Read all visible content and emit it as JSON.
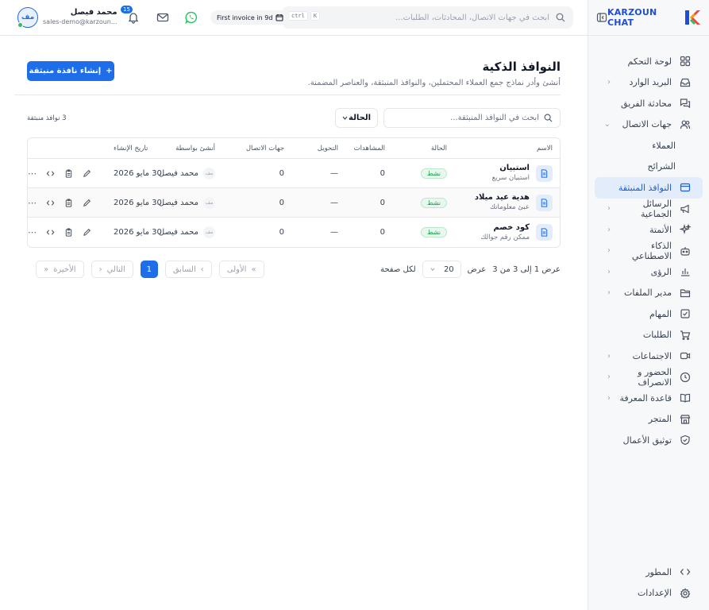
{
  "brand": {
    "name": "KARZOUN CHAT"
  },
  "sidebar": {
    "items": [
      {
        "label": "لوحة التحكم",
        "icon": "dashboard-icon",
        "has_children": false
      },
      {
        "label": "البريد الوارد",
        "icon": "inbox-icon",
        "has_children": true
      },
      {
        "label": "محادثة الفريق",
        "icon": "team-chat-icon",
        "has_children": false
      },
      {
        "label": "جهات الاتصال",
        "icon": "contacts-icon",
        "has_children": true,
        "expanded": true
      },
      {
        "label": "العملاء",
        "sub": true
      },
      {
        "label": "الشرائح",
        "sub": true
      },
      {
        "label": "النوافذ المنبثقة",
        "icon": "popup-icon",
        "active": true
      },
      {
        "label": "الرسائل الجماعية",
        "icon": "megaphone-icon",
        "has_children": true
      },
      {
        "label": "الأتمتة",
        "icon": "sparkles-icon",
        "has_children": true
      },
      {
        "label": "الذكاء الاصطناعي",
        "icon": "robot-icon",
        "has_children": true
      },
      {
        "label": "الرؤى",
        "icon": "chart-icon",
        "has_children": true
      },
      {
        "label": "مدير الملفات",
        "icon": "folder-icon",
        "has_children": true
      },
      {
        "label": "المهام",
        "icon": "task-icon",
        "has_children": false
      },
      {
        "label": "الطلبات",
        "icon": "cart-icon",
        "has_children": false
      },
      {
        "label": "الاجتماعات",
        "icon": "video-icon",
        "has_children": true
      },
      {
        "label": "الحضور و الانصراف",
        "icon": "clock-icon",
        "has_children": true
      },
      {
        "label": "قاعدة المعرفة",
        "icon": "book-icon",
        "has_children": true
      },
      {
        "label": "المتجر",
        "icon": "store-icon",
        "has_children": false
      },
      {
        "label": "توثيق الأعمال",
        "icon": "shield-check-icon",
        "has_children": false
      }
    ],
    "bottom": [
      {
        "label": "المطور",
        "icon": "code-icon"
      },
      {
        "label": "الإعدادات",
        "icon": "gear-icon"
      }
    ]
  },
  "topbar": {
    "search_placeholder": "ابحث في جهات الاتصال، المحادثات، الطلبات...",
    "shortcut_ctrl": "ctrl",
    "shortcut_key": "K",
    "invoice": "First invoice in 9d",
    "notifications_count": "15",
    "user_name": "محمد فيصل",
    "user_email": "sales-demo@karzoun...",
    "user_initials": "مف"
  },
  "page": {
    "title": "النوافذ الذكية",
    "subtitle": "أنشئ وأدر نماذج جمع العملاء المحتملين، والنوافذ المنبثقة، والعناصر المضمنة.",
    "create_button": "إنشاء نافذة منبثقة",
    "search_placeholder": "ابحث في النوافذ المنبثقة...",
    "status_filter": "الحالة",
    "count_label": "3 نوافذ منبثقة"
  },
  "table": {
    "headers": {
      "name": "الاسم",
      "status": "الحالة",
      "views": "المشاهدات",
      "conversion": "التحويل",
      "contacts": "جهات الاتصال",
      "created_by": "أنشئ بواسطة",
      "created_at": "تاريخ الإنشاء"
    },
    "rows": [
      {
        "title": "استبيان",
        "desc": "استبيان سريع",
        "status": "نشط",
        "views": "0",
        "conversion": "—",
        "contacts": "0",
        "creator": "محمد فيصل",
        "creator_initials": "مف",
        "date": "30 مايو 2026"
      },
      {
        "title": "هدية عيد ميلاد",
        "desc": "عبئ معلوماتك",
        "status": "نشط",
        "views": "0",
        "conversion": "—",
        "contacts": "0",
        "creator": "محمد فيصل",
        "creator_initials": "مف",
        "date": "30 مايو 2026"
      },
      {
        "title": "كود خصم",
        "desc": "ممكن رقم جوالك",
        "status": "نشط",
        "views": "0",
        "conversion": "—",
        "contacts": "0",
        "creator": "محمد فيصل",
        "creator_initials": "مف",
        "date": "30 مايو 2026"
      }
    ]
  },
  "pagination": {
    "showing": "عرض 1 إلى 3 من 3",
    "show_label": "عرض",
    "per_page": "20",
    "per_page_suffix": "لكل صفحة",
    "first": "الأولى",
    "prev": "السابق",
    "current": "1",
    "next": "التالي",
    "last": "الأخيرة"
  },
  "colors": {
    "accent": "#1d6ee8",
    "active_bg": "#e3ecfb",
    "success": "#16a34a"
  }
}
